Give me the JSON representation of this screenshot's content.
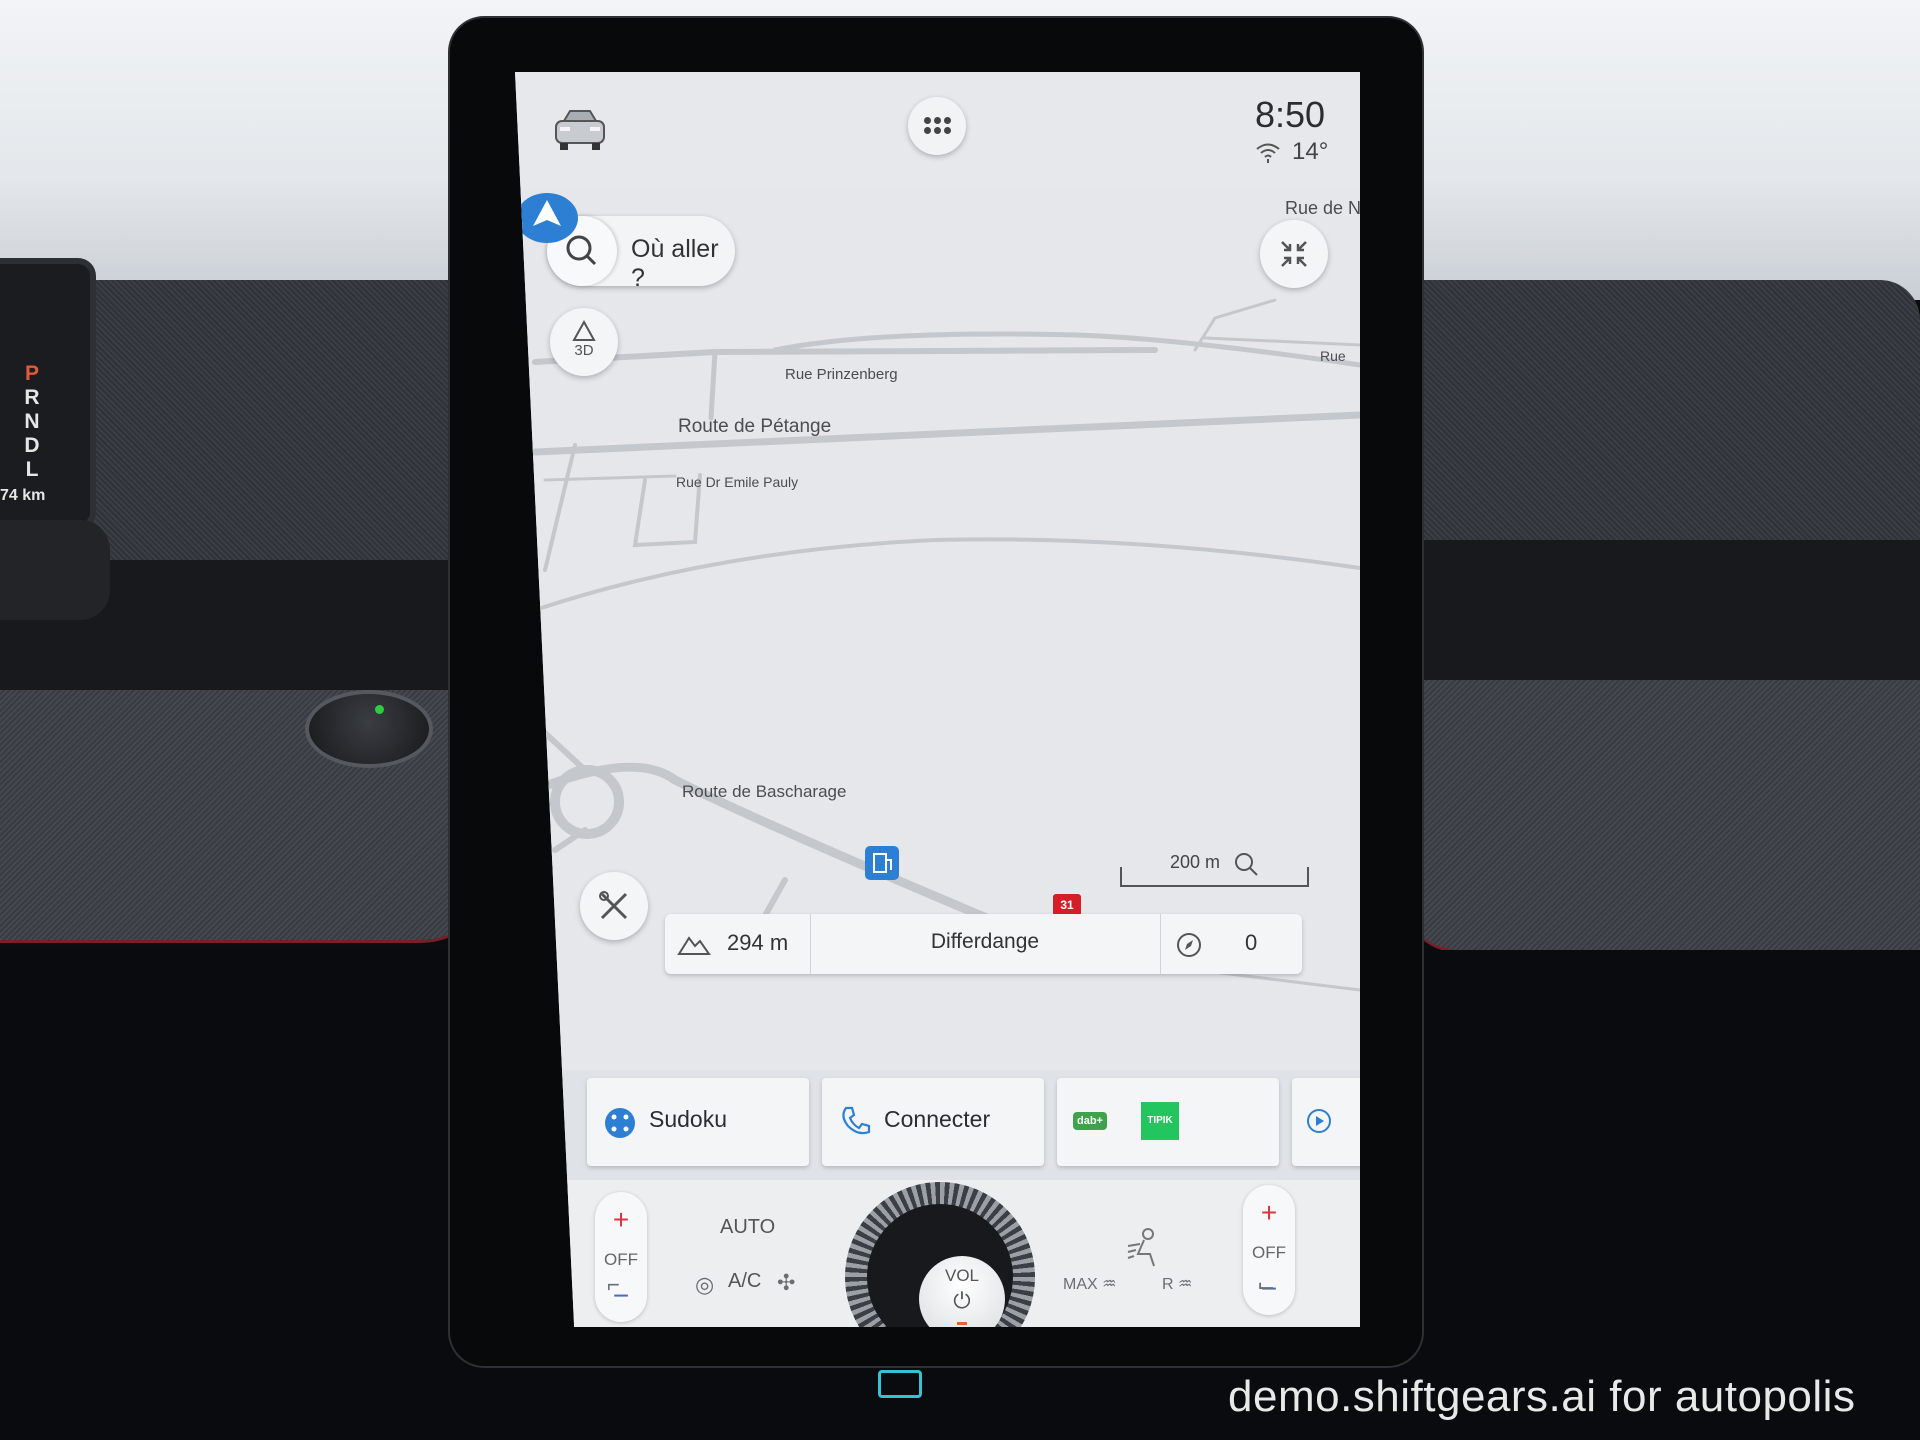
{
  "status_bar": {
    "time": "8:50",
    "temperature": "14°",
    "car_icon": "car-icon",
    "apps_icon": "grid-dots-icon",
    "wifi_icon": "wifi-icon"
  },
  "map": {
    "search_placeholder": "Où aller ?",
    "view_mode": "3D",
    "streets": {
      "rue_de_n": "Rue de N",
      "rue": "Rue",
      "rue_prinzenberg": "Rue Prinzenberg",
      "route_petange": "Route de Pétange",
      "rue_dr_emile_pauly": "Rue Dr Emile Pauly",
      "route_bascharage": "Route de Bascharage"
    },
    "road_number": "31",
    "scale": "200 m",
    "altitude": "294 m",
    "city": "Differdange",
    "heading": "0",
    "colors": {
      "position_arrow": "#2d7fd3",
      "road_marker": "#d41f28"
    }
  },
  "shortcuts": [
    {
      "label": "Sudoku",
      "icon": "sudoku-icon"
    },
    {
      "label": "Connecter",
      "icon": "phone-icon"
    },
    {
      "label": "",
      "icon": "dab-radio-icon",
      "badge": "TIPIK",
      "badge_color": "#22c55e"
    }
  ],
  "climate": {
    "left_off": "OFF",
    "right_off": "OFF",
    "auto": "AUTO",
    "ac": "A/C",
    "vol": "VOL",
    "max_label": "MAX",
    "rear_label": "R"
  },
  "cluster": {
    "gears": [
      "P",
      "R",
      "N",
      "D",
      "L"
    ],
    "odometer": "74 km"
  },
  "watermark": "demo.shiftgears.ai for autopolis"
}
